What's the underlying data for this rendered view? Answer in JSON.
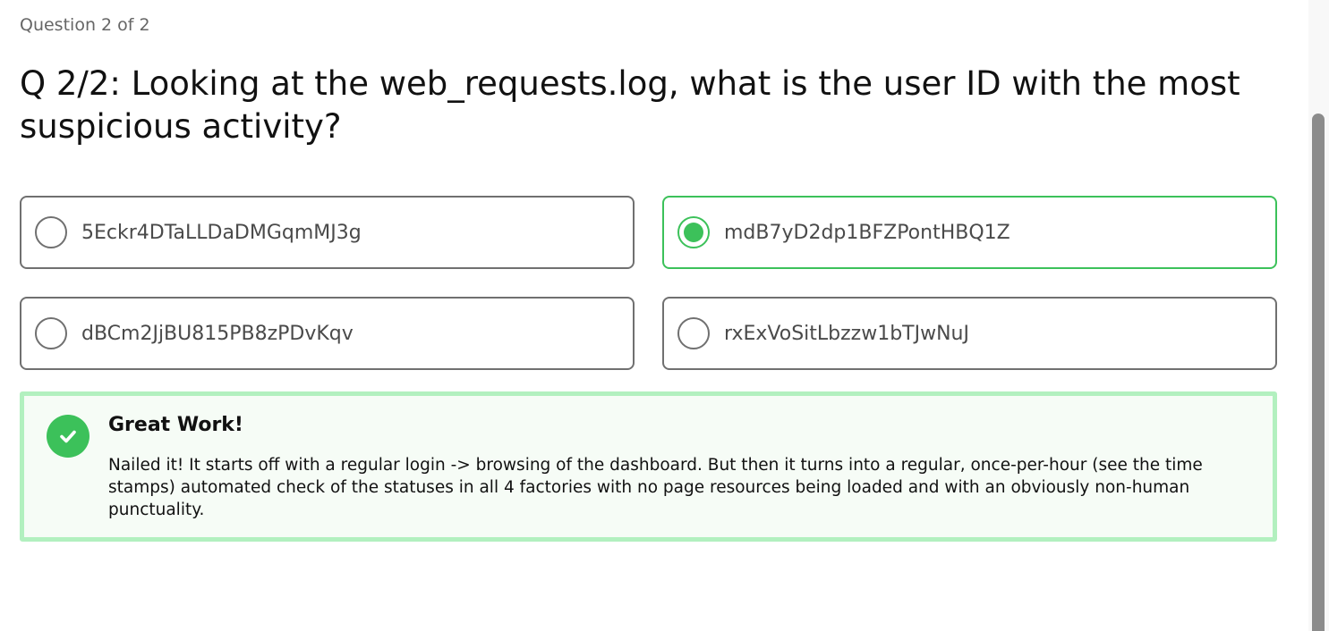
{
  "quiz": {
    "counter": "Question 2 of 2",
    "question": "Q 2/2: Looking at the web_requests.log, what is the user ID with the most suspicious activity?",
    "options": [
      {
        "label": "5Eckr4DTaLLDaDMGqmMJ3g",
        "selected": false
      },
      {
        "label": "mdB7yD2dp1BFZPontHBQ1Z",
        "selected": true
      },
      {
        "label": "dBCm2JjBU815PB8zPDvKqv",
        "selected": false
      },
      {
        "label": "rxExVoSitLbzzw1bTJwNuJ",
        "selected": false
      }
    ]
  },
  "feedback": {
    "icon": "check-circle-icon",
    "title": "Great Work!",
    "body": "Nailed it! It starts off with a regular login -> browsing of the dashboard. But then it turns into a regular, once-per-hour (see the time stamps) automated check of the statuses in all 4 factories with no page resources being loaded and with an obviously non-human punctuality."
  },
  "colors": {
    "accent_green": "#3cc15a",
    "feedback_border": "#b2f0bf",
    "feedback_background": "#f6fcf6",
    "option_border": "#707070"
  }
}
